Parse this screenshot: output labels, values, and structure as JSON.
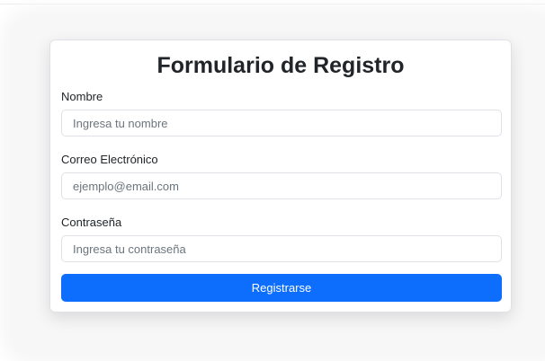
{
  "form": {
    "title": "Formulario de Registro",
    "fields": [
      {
        "label": "Nombre",
        "placeholder": "Ingresa tu nombre",
        "value": ""
      },
      {
        "label": "Correo Electrónico",
        "placeholder": "ejemplo@email.com",
        "value": ""
      },
      {
        "label": "Contraseña",
        "placeholder": "Ingresa tu contraseña",
        "value": ""
      }
    ],
    "submit_label": "Registrarse"
  },
  "colors": {
    "primary": "#0d6efd",
    "text": "#212529",
    "border": "#dee2e6",
    "placeholder": "#6c757d"
  }
}
